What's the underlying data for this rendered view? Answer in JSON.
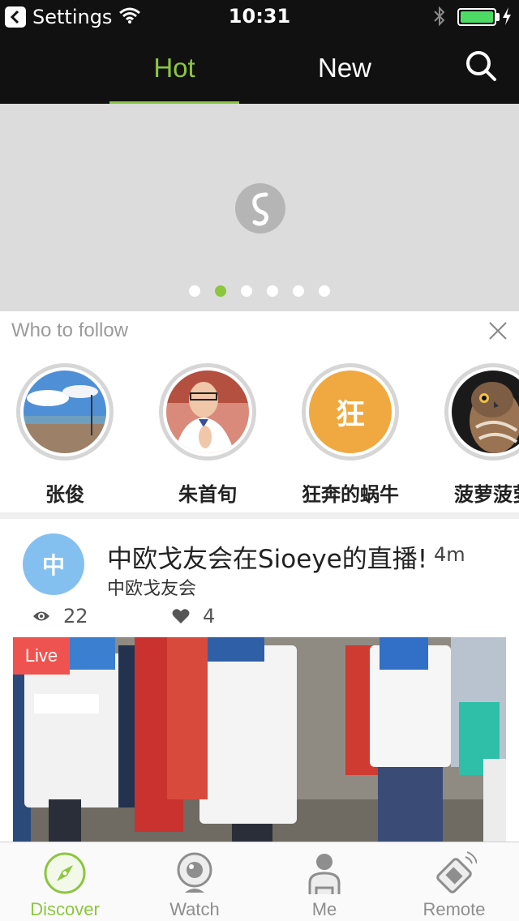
{
  "status_bar": {
    "back_app": "Settings",
    "time": "10:31",
    "battery_level": 1.0
  },
  "header": {
    "tabs": [
      {
        "label": "Hot",
        "active": true
      },
      {
        "label": "New",
        "active": false
      }
    ],
    "search_icon": "search-icon"
  },
  "banner": {
    "dot_count": 6,
    "active_index": 1
  },
  "who_to_follow": {
    "title": "Who to follow",
    "users": [
      {
        "name": "张俊",
        "avatar": "photo"
      },
      {
        "name": "朱首旬",
        "avatar": "photo"
      },
      {
        "name": "狂奔的蜗牛",
        "avatar_letter": "狂",
        "avatar_color": "#f0a940"
      },
      {
        "name": "菠萝菠萝",
        "avatar": "photo"
      }
    ]
  },
  "post": {
    "avatar_letter": "中",
    "avatar_color": "#84c0ef",
    "title": "中欧戈友会在Sioeye的直播!",
    "time": "4m",
    "author": "中欧戈友会",
    "views": "22",
    "likes": "4",
    "live_label": "Live"
  },
  "tabbar": {
    "items": [
      {
        "label": "Discover",
        "icon": "compass-icon",
        "active": true
      },
      {
        "label": "Watch",
        "icon": "webcam-icon",
        "active": false
      },
      {
        "label": "Me",
        "icon": "person-icon",
        "active": false
      },
      {
        "label": "Remote",
        "icon": "remote-icon",
        "active": false
      }
    ]
  },
  "colors": {
    "accent": "#8cc63f",
    "header_bg": "#111111",
    "live_red": "#ef5350"
  }
}
